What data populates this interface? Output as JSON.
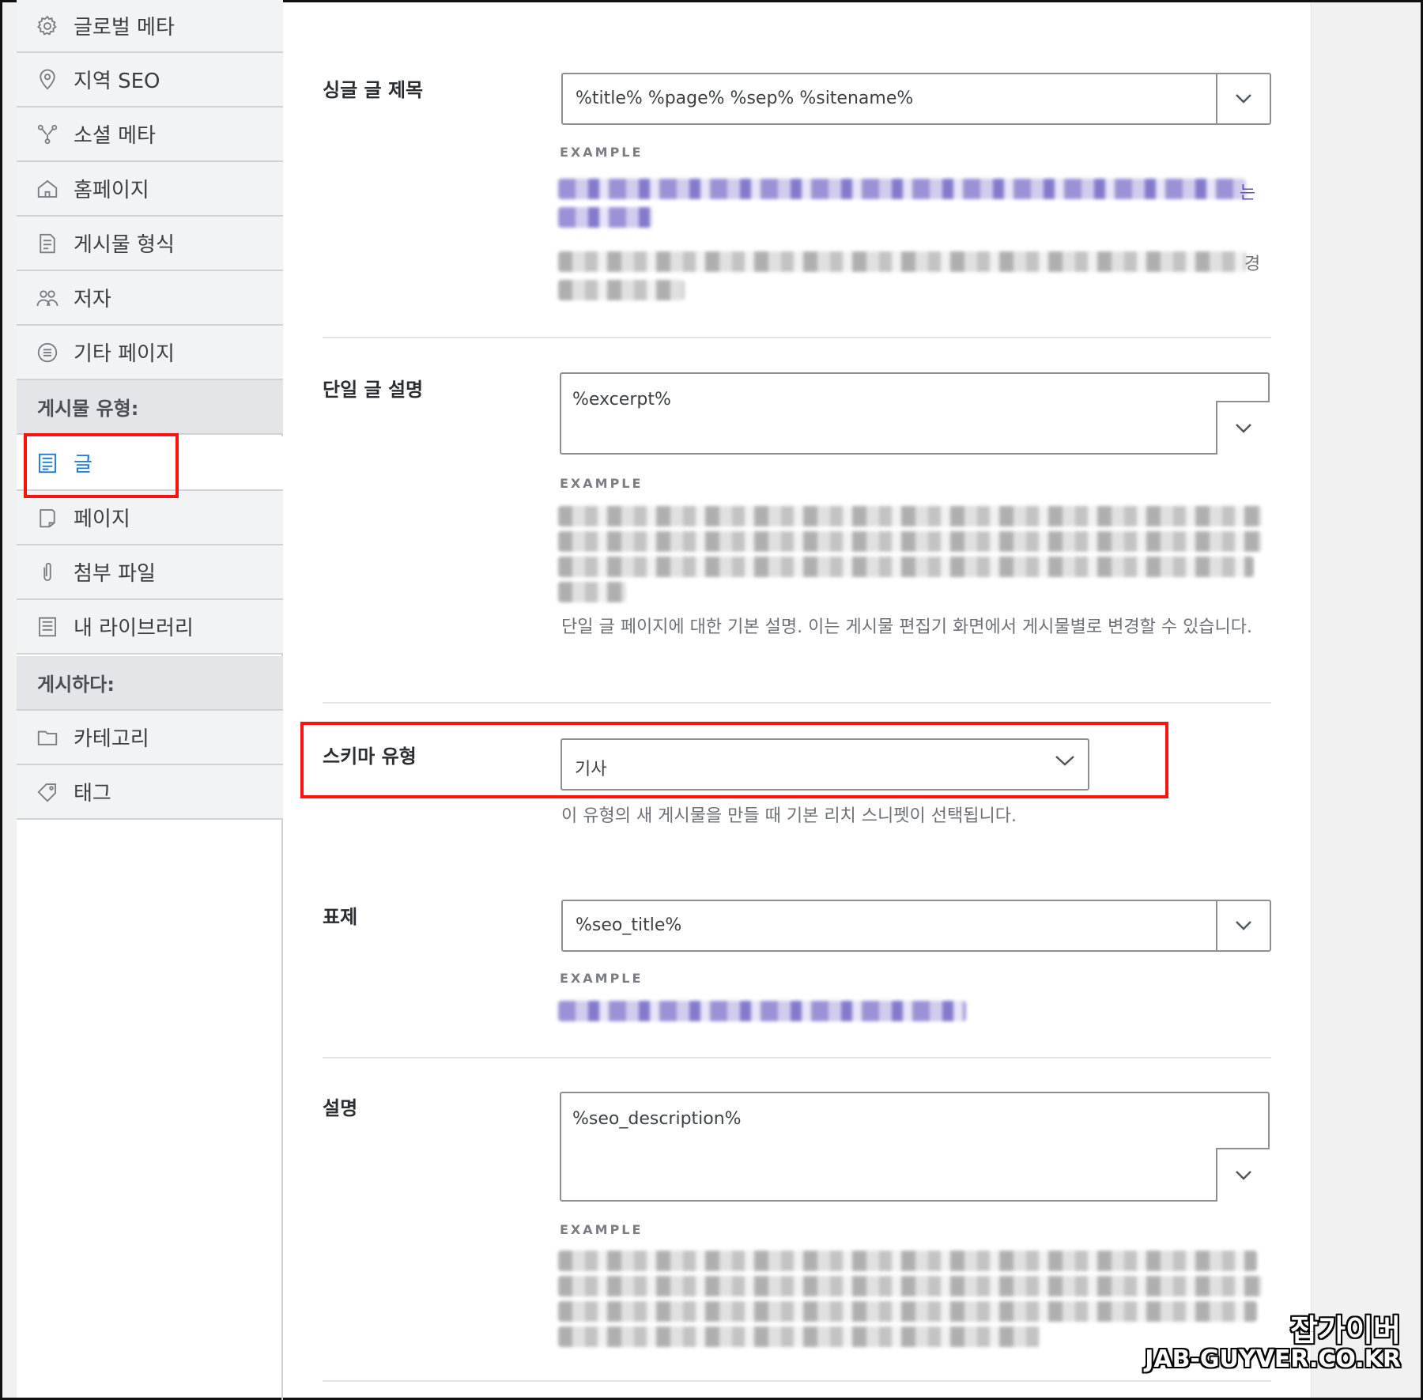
{
  "sidebar": {
    "items_top": [
      {
        "label": "글로벌 메타",
        "icon": "gear-icon"
      },
      {
        "label": "지역 SEO",
        "icon": "location-pin-icon"
      },
      {
        "label": "소셜 메타",
        "icon": "share-nodes-icon"
      },
      {
        "label": "홈페이지",
        "icon": "home-icon"
      },
      {
        "label": "게시물 형식",
        "icon": "document-icon"
      },
      {
        "label": "저자",
        "icon": "users-icon"
      },
      {
        "label": "기타 페이지",
        "icon": "list-circle-icon"
      }
    ],
    "post_types_heading": "게시물 유형:",
    "post_types": [
      {
        "label": "글",
        "icon": "post-icon",
        "active": true
      },
      {
        "label": "페이지",
        "icon": "page-icon"
      },
      {
        "label": "첨부 파일",
        "icon": "paperclip-icon"
      },
      {
        "label": "내 라이브러리",
        "icon": "library-icon"
      }
    ],
    "taxonomies_heading": "게시하다:",
    "taxonomies": [
      {
        "label": "카테고리",
        "icon": "folder-icon"
      },
      {
        "label": "태그",
        "icon": "tag-icon"
      }
    ]
  },
  "fields": {
    "single_title": {
      "label": "싱글 글 제목",
      "value": "%title% %page% %sep% %sitename%",
      "example_label": "EXAMPLE"
    },
    "single_desc": {
      "label": "단일 글 설명",
      "value": "%excerpt%",
      "example_label": "EXAMPLE",
      "help": "단일 글 페이지에 대한 기본 설명. 이는 게시물 편집기 화면에서 게시물별로 변경할 수 있습니다."
    },
    "schema_type": {
      "label": "스키마 유형",
      "value": "기사",
      "help": "이 유형의 새 게시물을 만들 때 기본 리치 스니펫이 선택됩니다."
    },
    "headline": {
      "label": "표제",
      "value": "%seo_title%",
      "example_label": "EXAMPLE"
    },
    "description": {
      "label": "설명",
      "value": "%seo_description%",
      "example_label": "EXAMPLE"
    }
  },
  "partial_text": {
    "title_tail": "는",
    "desc_tail": "경"
  },
  "watermark": {
    "line1": "잡가이버",
    "line2": "JAB-GUYVER.CO.KR"
  },
  "colors": {
    "accent": "#1e78d6",
    "highlight": "#ff1111"
  }
}
